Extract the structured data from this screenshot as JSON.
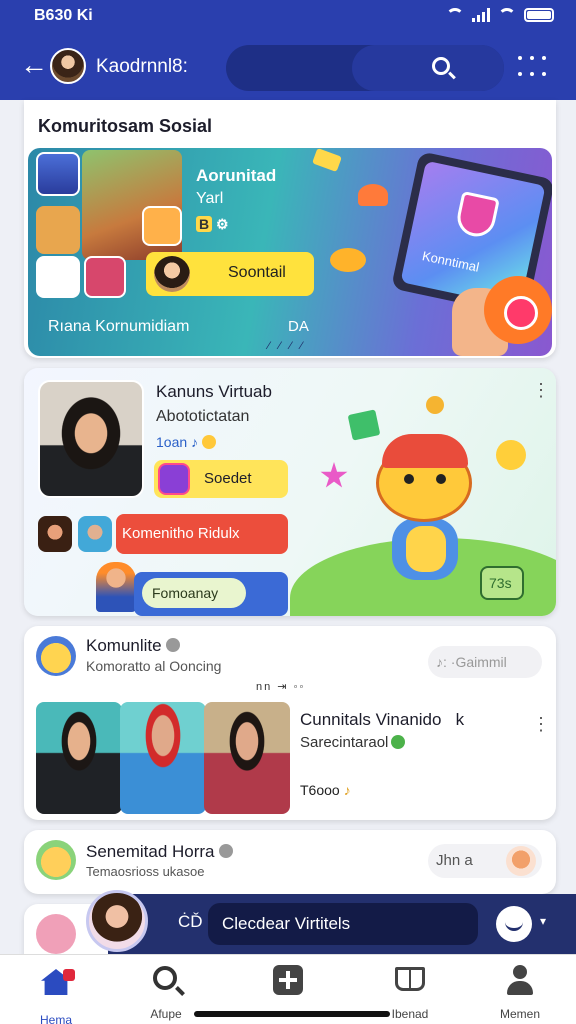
{
  "status_bar": {
    "time": "B630 Ki"
  },
  "header": {
    "title": "Kaodrnnl8:"
  },
  "card1": {
    "section_title": "Komuritosam Sosial",
    "heading": "Aorunitad",
    "subheading": "Yarl",
    "badges": "B",
    "social_button": "Soontail",
    "footer_left": "Rıana Kornumidiam",
    "footer_right": "DA",
    "tablet_label": "Konntimal"
  },
  "card2": {
    "title": "Kanuns Virtuab",
    "subtitle": "Abototictatan",
    "meta": "1oan ♪",
    "social_button": "Soedet",
    "red_button": "Komenitho Ridulx",
    "pill_button": "Fomoanay",
    "tag": "73s"
  },
  "card3": {
    "title": "Komunlite",
    "subtitle": "Komoratto al Ooncing",
    "music_pill": "♪: ·Gaimmil",
    "dots": "nn ⇥ ◦◦",
    "side_title": "Cunnitals Vinanido",
    "side_title_suffix": "k",
    "side_subtitle": "Sarecintaraol",
    "side_tag": "T6ooo"
  },
  "card4": {
    "title": "Senemitad Horra",
    "subtitle": "Temaosrioss ukasoe",
    "pill": "Jhn a"
  },
  "comment_bar": {
    "icon_text": "ĊĎ",
    "placeholder": "Clecdear Virtitels"
  },
  "bottom_nav": {
    "items": [
      {
        "label": "Hema"
      },
      {
        "label": "Afupe"
      },
      {
        "label": ""
      },
      {
        "label": "Ibenad"
      },
      {
        "label": "Memen"
      }
    ]
  },
  "colors": {
    "header_bg": "#2a3fae",
    "accent_yellow": "#ffe23d",
    "accent_red": "#ec4e3c",
    "comment_bar_bg": "#23306e"
  }
}
